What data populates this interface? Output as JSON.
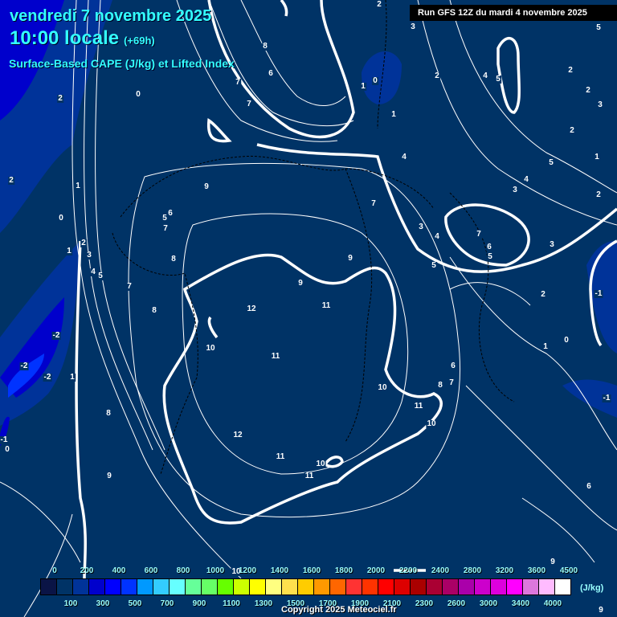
{
  "header": {
    "date": "vendredi 7 novembre 2025",
    "time": "10:00 locale",
    "lead": "(+69h)",
    "title": "Surface-Based CAPE (J/kg) et Lifted Index",
    "run": "Run GFS 12Z du mardi 4 novembre 2025"
  },
  "legend": {
    "unit": "(J/kg)",
    "colors": [
      "#0a1446",
      "#003366",
      "#003399",
      "#0000cc",
      "#0000ff",
      "#0033ff",
      "#0099ff",
      "#33ccff",
      "#66ffff",
      "#66ff99",
      "#66ff66",
      "#66ff00",
      "#ccff00",
      "#ffff00",
      "#ffff80",
      "#ffe04d",
      "#ffcc00",
      "#ff9900",
      "#ff6600",
      "#ff3333",
      "#ff3300",
      "#ff0000",
      "#dd0000",
      "#aa0000",
      "#aa0033",
      "#aa0066",
      "#aa00aa",
      "#cc00cc",
      "#dd00dd",
      "#ff00ff",
      "#dd77dd",
      "#ffbbff",
      "#ffffff"
    ],
    "labels": [
      "0",
      "100",
      "200",
      "300",
      "400",
      "500",
      "600",
      "700",
      "800",
      "900",
      "1000",
      "1100",
      "1200",
      "1300",
      "1400",
      "1500",
      "1600",
      "1700",
      "1800",
      "1900",
      "2000",
      "2100",
      "2200",
      "2300",
      "2400",
      "2600",
      "2800",
      "3000",
      "3200",
      "3400",
      "3600",
      "4000",
      "4500"
    ]
  },
  "lifted_index_labels": [
    "2",
    "3",
    "5",
    "8",
    "6",
    "7",
    "7",
    "0",
    "2",
    "0",
    "1",
    "2",
    "4",
    "5",
    "2",
    "2",
    "3",
    "1",
    "2",
    "4",
    "5",
    "1",
    "9",
    "3",
    "4",
    "2",
    "2",
    "1",
    "7",
    "6",
    "5",
    "7",
    "0",
    "3",
    "4",
    "7",
    "6",
    "5",
    "3",
    "2",
    "1",
    "3",
    "4",
    "5",
    "8",
    "9",
    "5",
    "9",
    "7",
    "2",
    "-1",
    "12",
    "11",
    "8",
    "-2",
    "10",
    "1",
    "0",
    "11",
    "-2",
    "-2",
    "1",
    "6",
    "7",
    "8",
    "10",
    "11",
    "-1",
    "8",
    "10",
    "12",
    "-1",
    "0",
    "11",
    "10",
    "11",
    "9",
    "6",
    "10",
    "9",
    "9"
  ],
  "copyright": "Copyright 2025 Meteociel.fr"
}
